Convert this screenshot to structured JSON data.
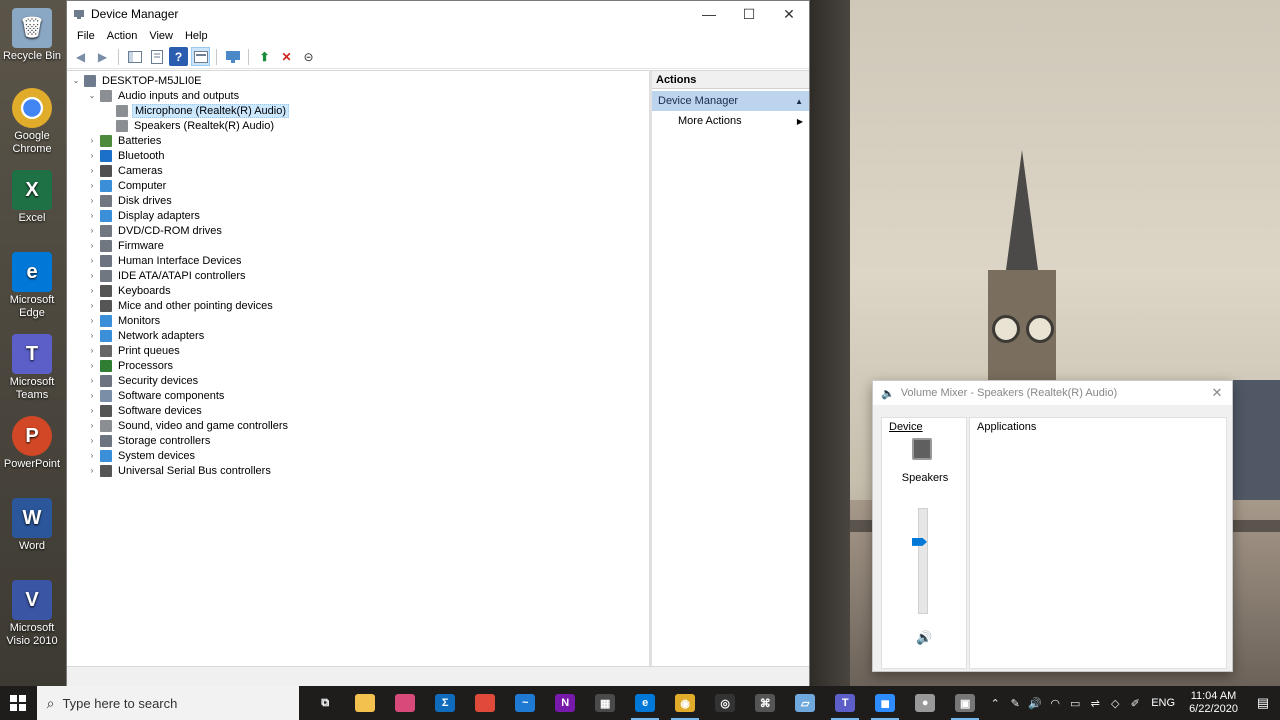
{
  "desktop": {
    "icons": [
      {
        "label": "Recycle Bin",
        "icon": "recycle-bin-icon",
        "color": "#8aa7c4"
      },
      {
        "label": "Google Chrome",
        "icon": "chrome-icon",
        "color": "#e0ac2a"
      },
      {
        "label": "Excel",
        "icon": "excel-icon",
        "color": "#1e7145",
        "glyph": "X"
      },
      {
        "label": "Microsoft Edge",
        "icon": "edge-icon",
        "color": "#0078d7",
        "glyph": "e"
      },
      {
        "label": "Microsoft Teams",
        "icon": "teams-icon",
        "color": "#5b5fc7",
        "glyph": "T"
      },
      {
        "label": "PowerPoint",
        "icon": "powerpoint-icon",
        "color": "#d24726",
        "glyph": "P"
      },
      {
        "label": "Word",
        "icon": "word-icon",
        "color": "#2b579a",
        "glyph": "W"
      },
      {
        "label": "Microsoft Visio 2010",
        "icon": "visio-icon",
        "color": "#3955a3",
        "glyph": "V"
      }
    ]
  },
  "device_manager": {
    "title": "Device Manager",
    "window_controls": {
      "minimize": "—",
      "maximize": "☐",
      "close": "✕"
    },
    "menu": [
      "File",
      "Action",
      "View",
      "Help"
    ],
    "tree": {
      "root": "DESKTOP-M5JLI0E",
      "audio": "Audio inputs and outputs",
      "audio_children": [
        "Microphone (Realtek(R) Audio)",
        "Speakers (Realtek(R) Audio)"
      ],
      "categories": [
        "Batteries",
        "Bluetooth",
        "Cameras",
        "Computer",
        "Disk drives",
        "Display adapters",
        "DVD/CD-ROM drives",
        "Firmware",
        "Human Interface Devices",
        "IDE ATA/ATAPI controllers",
        "Keyboards",
        "Mice and other pointing devices",
        "Monitors",
        "Network adapters",
        "Print queues",
        "Processors",
        "Security devices",
        "Software components",
        "Software devices",
        "Sound, video and game controllers",
        "Storage controllers",
        "System devices",
        "Universal Serial Bus controllers"
      ]
    },
    "actions": {
      "header": "Actions",
      "group": "Device Manager",
      "item": "More Actions"
    }
  },
  "volume_mixer": {
    "title": "Volume Mixer - Speakers (Realtek(R) Audio)",
    "device_label": "Device",
    "applications_label": "Applications",
    "speaker_label": "Speakers",
    "volume_level": 0.68
  },
  "taskbar": {
    "search_placeholder": "Type here to search",
    "language": "ENG",
    "time": "11:04 AM",
    "date": "6/22/2020",
    "apps": [
      {
        "name": "task-view-icon",
        "color": "#1e1d1c",
        "glyph": "⧉"
      },
      {
        "name": "file-explorer-icon",
        "color": "#f2c14e",
        "glyph": ""
      },
      {
        "name": "paint-icon",
        "color": "#d84a7a",
        "glyph": ""
      },
      {
        "name": "sigma-app-icon",
        "color": "#0f6cbd",
        "glyph": "Σ"
      },
      {
        "name": "snip-sketch-icon",
        "color": "#e04a3a",
        "glyph": ""
      },
      {
        "name": "stock-chart-icon",
        "color": "#1f7ad4",
        "glyph": "~"
      },
      {
        "name": "onenote-icon",
        "color": "#7719aa",
        "glyph": "N"
      },
      {
        "name": "calculator-icon",
        "color": "#4a4a4a",
        "glyph": "▦"
      },
      {
        "name": "edge-icon",
        "color": "#0078d7",
        "glyph": "e"
      },
      {
        "name": "chrome-icon",
        "color": "#e0ac2a",
        "glyph": "◉"
      },
      {
        "name": "obs-icon",
        "color": "#333333",
        "glyph": "◎"
      },
      {
        "name": "keyboard-icon",
        "color": "#555555",
        "glyph": "⌘"
      },
      {
        "name": "tablet-icon",
        "color": "#6fa8dc",
        "glyph": "▱"
      },
      {
        "name": "teams-icon",
        "color": "#5b5fc7",
        "glyph": "T"
      },
      {
        "name": "zoom-icon",
        "color": "#2d8cff",
        "glyph": "◼"
      },
      {
        "name": "app-circle-icon",
        "color": "#999999",
        "glyph": "●"
      },
      {
        "name": "device-manager-icon",
        "color": "#777777",
        "glyph": "▣"
      }
    ]
  }
}
